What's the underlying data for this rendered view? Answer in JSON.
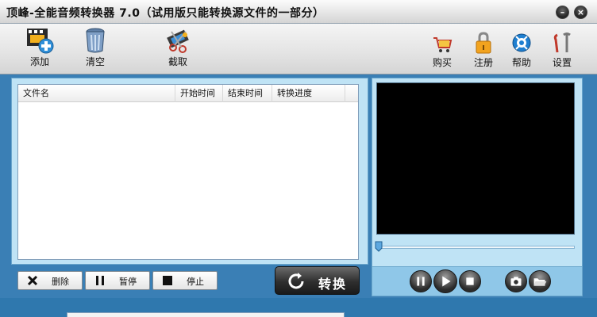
{
  "window": {
    "title": "顶峰-全能音频转换器 7.0（试用版只能转换源文件的一部分）",
    "min_icon": "minimize-icon",
    "close_icon": "close-icon"
  },
  "toolbar": {
    "left": [
      {
        "label": "添加",
        "icon": "film-add-icon"
      },
      {
        "label": "清空",
        "icon": "trash-can-icon"
      },
      {
        "label": "截取",
        "icon": "scissors-film-icon"
      }
    ],
    "right": [
      {
        "label": "购买",
        "icon": "shopping-cart-icon"
      },
      {
        "label": "注册",
        "icon": "padlock-icon"
      },
      {
        "label": "帮助",
        "icon": "help-icon"
      },
      {
        "label": "设置",
        "icon": "tools-icon"
      }
    ]
  },
  "file_list": {
    "columns": [
      "文件名",
      "开始时间",
      "结束时间",
      "转换进度"
    ],
    "rows": []
  },
  "controls": {
    "delete_label": "删除",
    "pause_label": "暂停",
    "stop_label": "停止",
    "convert_label": "转换"
  },
  "player": {
    "progress": 0,
    "buttons": [
      "pause-icon",
      "play-icon",
      "stop-icon",
      "snapshot-icon",
      "open-folder-icon"
    ]
  },
  "colors": {
    "panel_bg": "#bfe3f5",
    "window_bg": "#3a7fb5",
    "video_bg": "#000000"
  }
}
